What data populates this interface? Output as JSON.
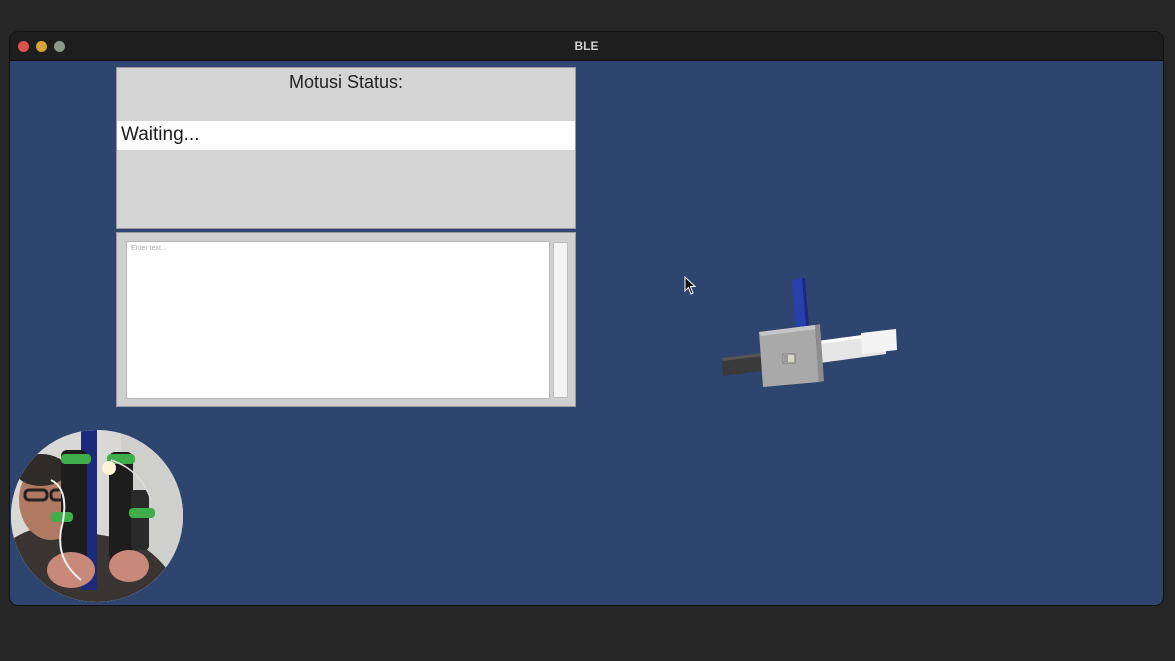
{
  "window": {
    "title": "BLE"
  },
  "status_panel": {
    "title": "Motusi Status:",
    "value": "Waiting..."
  },
  "log_panel": {
    "placeholder": "Enter text..."
  },
  "colors": {
    "window_background": "#2e4570",
    "titlebar": "#1e1e1e",
    "panel": "#d4d4d4",
    "close": "#d9534b",
    "minimize": "#d8a43a",
    "maximize": "#8a9a86"
  },
  "icons": {
    "cursor": "mouse-pointer-icon"
  }
}
